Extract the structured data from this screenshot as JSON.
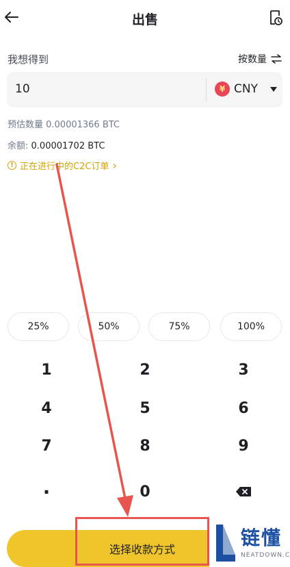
{
  "header": {
    "title": "出售",
    "back_icon": "back-arrow-icon",
    "history_icon": "order-history-icon"
  },
  "form": {
    "want_label": "我想得到",
    "toggle_label": "按数量",
    "amount_value": "10",
    "currency_symbol": "¥",
    "currency": "CNY",
    "estimate": "预估数量 0.00001366 BTC",
    "balance_label": "余额:",
    "balance_value": "0.00001702 BTC",
    "orders_text": "正在进行中的C2C订单",
    "orders_icon_glyph": "!",
    "orders_chevron": "›"
  },
  "percent_options": [
    "25%",
    "50%",
    "75%",
    "100%"
  ],
  "keypad": {
    "rows": [
      [
        "1",
        "2",
        "3"
      ],
      [
        "4",
        "5",
        "6"
      ],
      [
        "7",
        "8",
        "9"
      ]
    ],
    "dot": "·",
    "zero": "0",
    "delete_icon": "backspace-icon"
  },
  "submit": {
    "label": "选择收款方式"
  },
  "watermark": {
    "text": "链懂",
    "sub": "NEATDOWN.COM"
  },
  "colors": {
    "accent": "#f0c52b",
    "annotation": "#e8554e",
    "currency_badge": "#e84557",
    "link": "#d3a200"
  }
}
